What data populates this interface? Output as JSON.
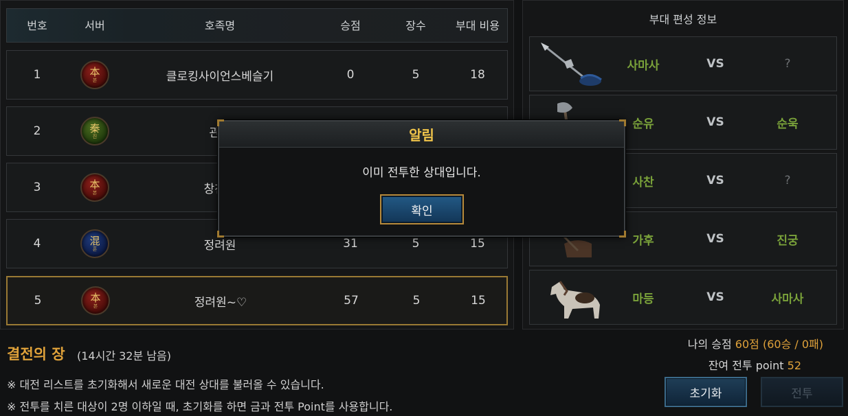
{
  "table": {
    "headers": {
      "number": "번호",
      "server": "서버",
      "clan": "호족명",
      "score": "승점",
      "generals": "장수",
      "cost": "부대 비용"
    },
    "rows": [
      {
        "number": "1",
        "server_char": "本",
        "server_sub": "본",
        "server_color": "red",
        "clan": "클로킹사이언스베슬기",
        "score": "0",
        "generals": "5",
        "cost": "18"
      },
      {
        "number": "2",
        "server_char": "秦",
        "server_sub": "진",
        "server_color": "green",
        "clan": "관성",
        "score": "",
        "generals": "",
        "cost": ""
      },
      {
        "number": "3",
        "server_char": "本",
        "server_sub": "본",
        "server_color": "red",
        "clan": "창천의",
        "score": "",
        "generals": "",
        "cost": ""
      },
      {
        "number": "4",
        "server_char": "混",
        "server_sub": "혼",
        "server_color": "blue",
        "clan": "정려원",
        "score": "31",
        "generals": "5",
        "cost": "15"
      },
      {
        "number": "5",
        "server_char": "本",
        "server_sub": "본",
        "server_color": "red",
        "clan": "정려원~♡",
        "score": "57",
        "generals": "5",
        "cost": "15"
      }
    ]
  },
  "formation": {
    "title": "부대 편성 정보",
    "vs_label": "VS",
    "matches": [
      {
        "unit_icon": "spear-unit-icon",
        "left": "사마사",
        "right": "?"
      },
      {
        "unit_icon": "axe-unit-icon",
        "left": "순유",
        "right": "순욱"
      },
      {
        "unit_icon": "soldier-unit-icon",
        "left": "사찬",
        "right": "?"
      },
      {
        "unit_icon": "cavalry-unit-icon",
        "left": "가후",
        "right": "진궁"
      },
      {
        "unit_icon": "horse-unit-icon",
        "left": "마등",
        "right": "사마사"
      }
    ]
  },
  "bottom": {
    "title": "결전의 장",
    "remaining": "(14시간 32분 남음)",
    "note1": "※ 대전 리스트를 초기화해서 새로운 대전 상대를 불러올 수 있습니다.",
    "note2": "※ 전투를 치른 대상이 2명 이하일 때, 초기화를 하면 금과 전투 Point를 사용합니다.",
    "my_score_label": "나의 승점",
    "my_score_value": "60점 (60승 / 0패)",
    "remaining_point_label": "잔여 전투 point",
    "remaining_point_value": "52",
    "reset_button": "초기화",
    "battle_button": "전투"
  },
  "modal": {
    "title": "알림",
    "message": "이미 전투한 상대입니다.",
    "confirm": "확인"
  },
  "colors": {
    "accent_gold": "#e0a23a",
    "name_green": "#7aa23a",
    "selected_border": "#9a7a34"
  }
}
